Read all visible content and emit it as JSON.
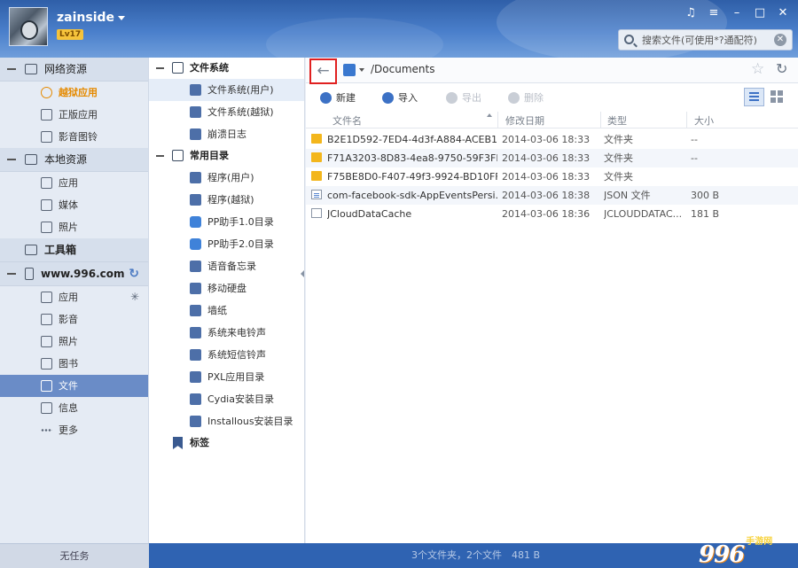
{
  "header": {
    "username": "zainside",
    "level": "Lv17",
    "search_placeholder": "搜索文件(可使用*?通配符)"
  },
  "leftnav": {
    "groups": [
      {
        "label": "网络资源",
        "items": [
          "越狱应用",
          "正版应用",
          "影音图铃"
        ]
      },
      {
        "label": "本地资源",
        "items": [
          "应用",
          "媒体",
          "照片"
        ]
      },
      {
        "label": "工具箱",
        "items": []
      },
      {
        "label": "www.996.com",
        "items": [
          "应用",
          "影音",
          "照片",
          "图书",
          "文件",
          "信息",
          "更多"
        ]
      }
    ],
    "active_item": "文件",
    "task_label": "无任务"
  },
  "tree": {
    "sections": [
      {
        "label": "文件系统",
        "items": [
          "文件系统(用户)",
          "文件系统(越狱)",
          "崩溃日志"
        ]
      },
      {
        "label": "常用目录",
        "items": [
          "程序(用户)",
          "程序(越狱)",
          "PP助手1.0目录",
          "PP助手2.0目录",
          "语音备忘录",
          "移动硬盘",
          "墙纸",
          "系统来电铃声",
          "系统短信铃声",
          "PXL应用目录",
          "Cydia安装目录",
          "Installous安装目录"
        ]
      }
    ],
    "bookmark_label": "标签",
    "selected_item": "文件系统(用户)"
  },
  "address": {
    "path": "/Documents"
  },
  "toolbar": {
    "new_label": "新建",
    "import_label": "导入",
    "export_label": "导出",
    "delete_label": "删除"
  },
  "columns": {
    "name": "文件名",
    "date": "修改日期",
    "type": "类型",
    "size": "大小"
  },
  "files": [
    {
      "name": "B2E1D592-7ED4-4d3f-A884-ACEB1...",
      "date": "2014-03-06 18:33",
      "type": "文件夹",
      "size": "--",
      "kind": "folder"
    },
    {
      "name": "F71A3203-8D83-4ea8-9750-59F3FB...",
      "date": "2014-03-06 18:33",
      "type": "文件夹",
      "size": "--",
      "kind": "folder"
    },
    {
      "name": "F75BE8D0-F407-49f3-9924-BD10FF...",
      "date": "2014-03-06 18:33",
      "type": "文件夹",
      "size": "",
      "kind": "folder"
    },
    {
      "name": "com-facebook-sdk-AppEventsPersi...",
      "date": "2014-03-06 18:38",
      "type": "JSON 文件",
      "size": "300 B",
      "kind": "json"
    },
    {
      "name": "JCloudDataCache",
      "date": "2014-03-06 18:36",
      "type": "JCLOUDDATAC...",
      "size": "181 B",
      "kind": "file"
    }
  ],
  "status": {
    "summary": "3个文件夹，2个文件　481 B"
  },
  "watermark": {
    "big": "996",
    "small": "手游网"
  }
}
